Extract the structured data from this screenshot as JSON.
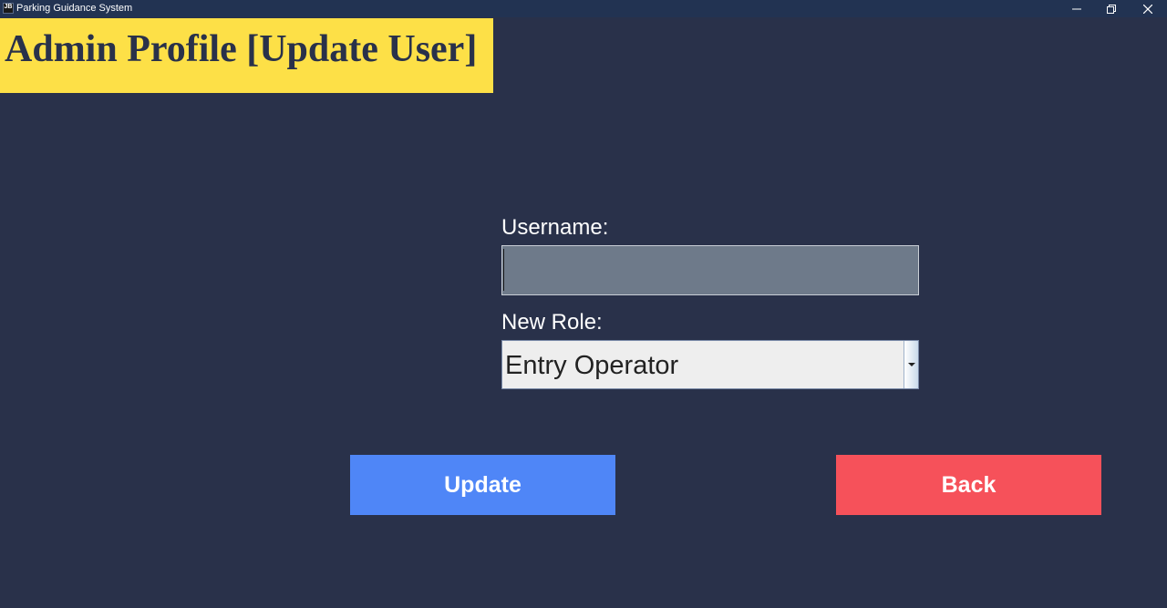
{
  "window": {
    "icon_text": "JB",
    "title": "Parking Guidance System",
    "controls": [
      "minimize-icon",
      "restore-icon",
      "close-icon"
    ]
  },
  "header": {
    "title": "Admin Profile [Update User]",
    "background": "#fde047"
  },
  "form": {
    "username_label": "Username:",
    "username_value": "",
    "role_label": "New Role:",
    "role_selected": "Entry Operator"
  },
  "buttons": {
    "update_label": "Update",
    "back_label": "Back"
  },
  "colors": {
    "background": "#29314a",
    "update": "#4f86f7",
    "back": "#f6515a",
    "input": "#6e7a8a"
  }
}
